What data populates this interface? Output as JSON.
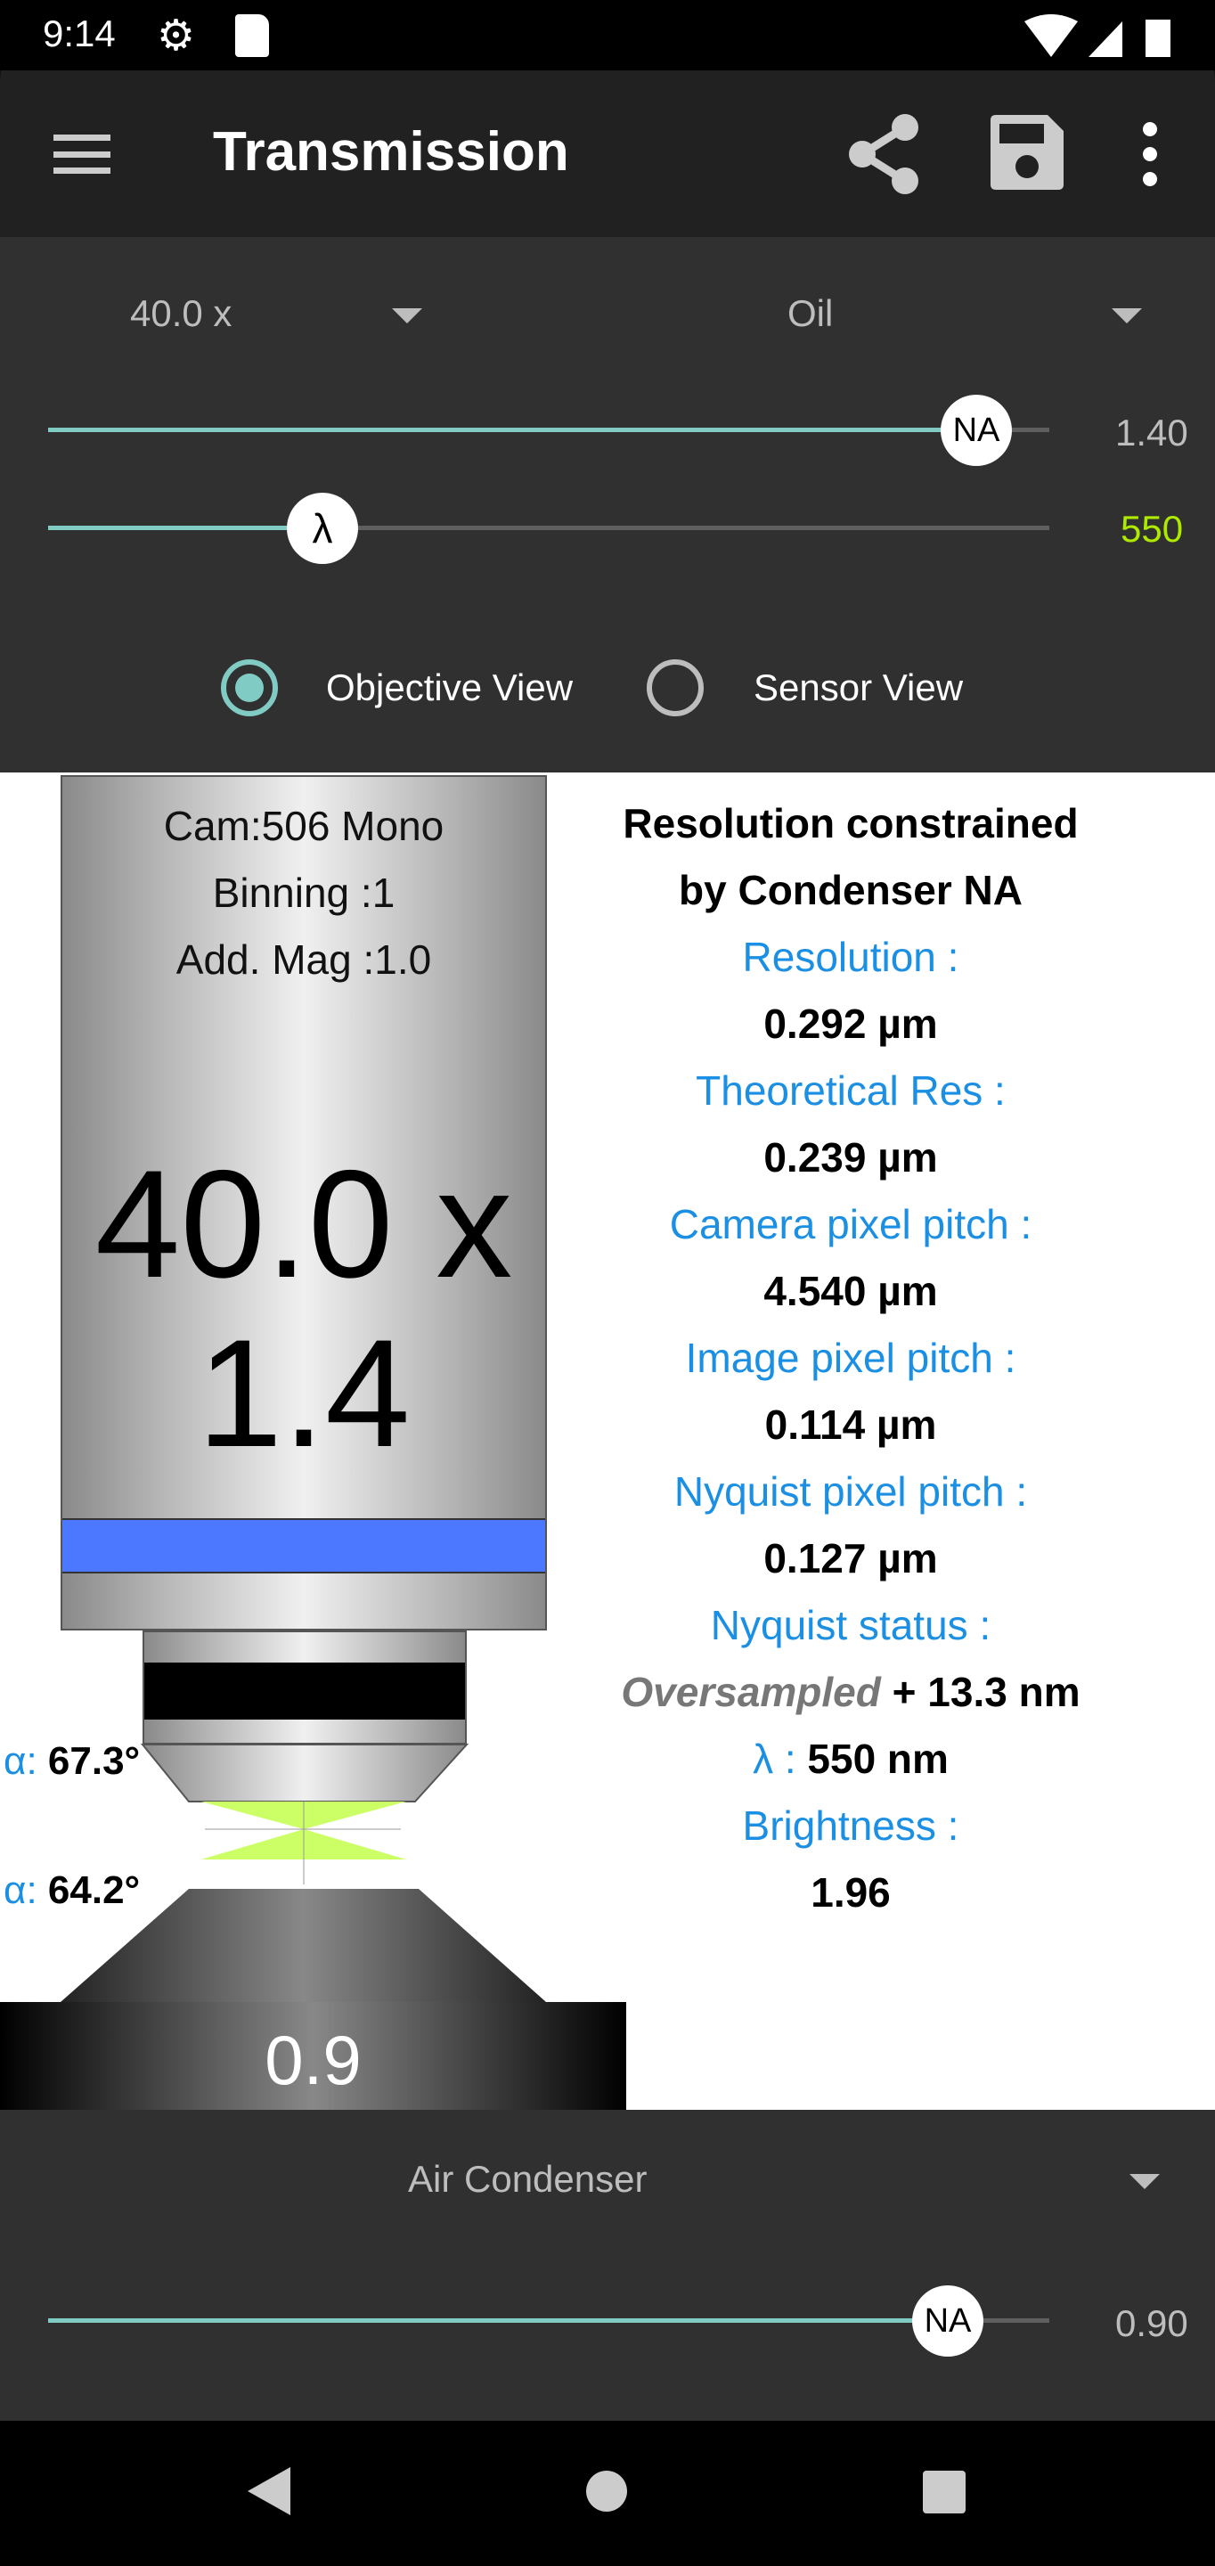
{
  "status_bar": {
    "time": "9:14",
    "icons": [
      "gear-icon",
      "sd-card-icon",
      "wifi-icon",
      "signal-icon",
      "battery-icon"
    ]
  },
  "toolbar": {
    "title": "Transmission",
    "icons": [
      "menu-icon",
      "share-icon",
      "save-icon",
      "more-vert-icon"
    ]
  },
  "objective": {
    "magnification": "40.0 x",
    "immersion": "Oil",
    "na_thumb": "NA",
    "na_value": "1.40",
    "na_fraction": 0.95,
    "lambda_thumb": "λ",
    "lambda_value": "550",
    "lambda_fraction": 0.27,
    "lambda_color": "#aeea00"
  },
  "view_mode": {
    "options": [
      "Objective View",
      "Sensor View"
    ],
    "selected": "Objective View"
  },
  "diagram": {
    "cam": "Cam:506 Mono",
    "binning": "Binning :1",
    "add_mag": "Add. Mag :1.0",
    "mag": "40.0 x",
    "na": "1.4",
    "alpha_label": "α:",
    "alpha_objective": "67.3°",
    "alpha_condenser": "64.2°",
    "condenser_na": "0.9",
    "band_color": "#4b78ff",
    "cone_color": "#ccff66"
  },
  "results": {
    "heading1": "Resolution constrained",
    "heading2": "by Condenser NA",
    "items": [
      {
        "label": "Resolution :",
        "value": "0.292 µm"
      },
      {
        "label": "Theoretical Res :",
        "value": "0.239 µm"
      },
      {
        "label": "Camera pixel pitch :",
        "value": "4.540 µm"
      },
      {
        "label": "Image pixel pitch :",
        "value": "0.114 µm"
      },
      {
        "label": "Nyquist pixel pitch :",
        "value": "0.127 µm"
      }
    ],
    "nyquist_label": "Nyquist status :",
    "nyquist_status": "Oversampled",
    "nyquist_delta": "+  13.3 nm",
    "lambda_label": "λ :",
    "lambda_value": "550 nm",
    "brightness_label": "Brightness :",
    "brightness_value": "1.96"
  },
  "condenser": {
    "type": "Air Condenser",
    "na_thumb": "NA",
    "na_value": "0.90",
    "na_fraction": 0.9
  },
  "accent": "#80cbc4",
  "label_blue": "#1a8fe3"
}
